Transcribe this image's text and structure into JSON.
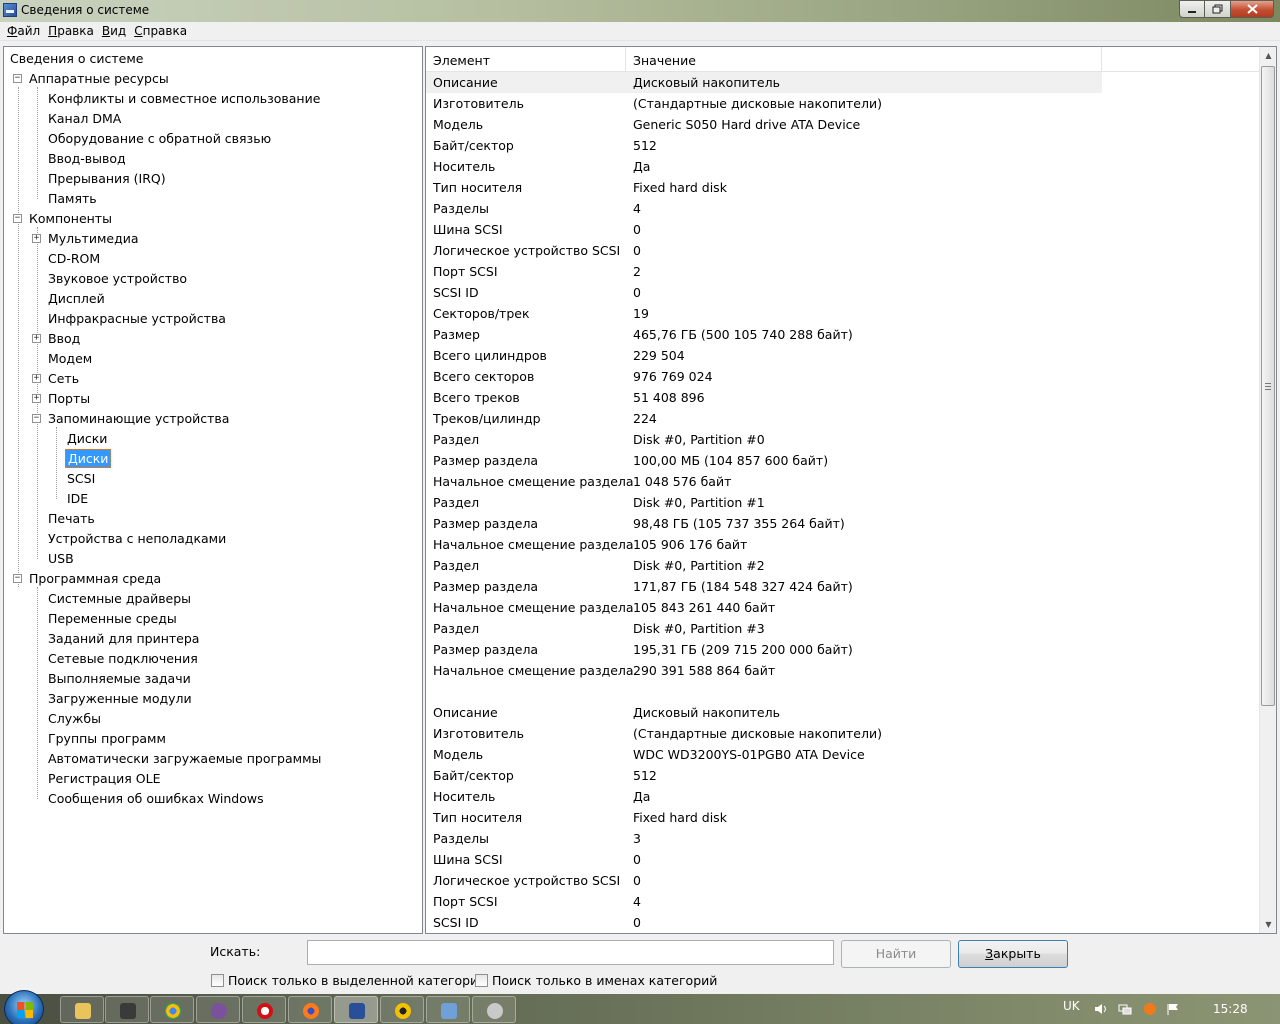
{
  "window": {
    "title": "Сведения о системе"
  },
  "menu": [
    {
      "label_ul": "Ф",
      "label_rest": "айл"
    },
    {
      "label_ul": "П",
      "label_rest": "равка"
    },
    {
      "label_ul": "В",
      "label_rest": "ид"
    },
    {
      "label_ul": "С",
      "label_rest": "правка"
    }
  ],
  "tree": [
    {
      "label": "Сведения о системе"
    },
    {
      "label": "Аппаратные ресурсы"
    },
    {
      "label": "Конфликты и совместное использование"
    },
    {
      "label": "Канал DMA"
    },
    {
      "label": "Оборудование с обратной связью"
    },
    {
      "label": "Ввод-вывод"
    },
    {
      "label": "Прерывания (IRQ)"
    },
    {
      "label": "Память"
    },
    {
      "label": "Компоненты"
    },
    {
      "label": "Мультимедиа"
    },
    {
      "label": "CD-ROM"
    },
    {
      "label": "Звуковое устройство"
    },
    {
      "label": "Дисплей"
    },
    {
      "label": "Инфракрасные устройства"
    },
    {
      "label": "Ввод"
    },
    {
      "label": "Модем"
    },
    {
      "label": "Сеть"
    },
    {
      "label": "Порты"
    },
    {
      "label": "Запоминающие устройства"
    },
    {
      "label": "Диски"
    },
    {
      "label": "Диски"
    },
    {
      "label": "SCSI"
    },
    {
      "label": "IDE"
    },
    {
      "label": "Печать"
    },
    {
      "label": "Устройства с неполадками"
    },
    {
      "label": "USB"
    },
    {
      "label": "Программная среда"
    },
    {
      "label": "Системные драйверы"
    },
    {
      "label": "Переменные среды"
    },
    {
      "label": "Заданий для принтера"
    },
    {
      "label": "Сетевые подключения"
    },
    {
      "label": "Выполняемые задачи"
    },
    {
      "label": "Загруженные модули"
    },
    {
      "label": "Службы"
    },
    {
      "label": "Группы программ"
    },
    {
      "label": "Автоматически загружаемые программы"
    },
    {
      "label": "Регистрация OLE"
    },
    {
      "label": "Сообщения об ошибках Windows"
    }
  ],
  "list": {
    "columns": [
      "Элемент",
      "Значение"
    ],
    "rows": [
      [
        "Описание",
        "Дисковый накопитель"
      ],
      [
        "Изготовитель",
        "(Стандартные дисковые накопители)"
      ],
      [
        "Модель",
        "Generic S050 Hard drive ATA Device"
      ],
      [
        "Байт/сектор",
        "512"
      ],
      [
        "Носитель",
        "Да"
      ],
      [
        "Тип носителя",
        "Fixed hard disk"
      ],
      [
        "Разделы",
        "4"
      ],
      [
        "Шина SCSI",
        "0"
      ],
      [
        "Логическое устройство SCSI",
        "0"
      ],
      [
        "Порт SCSI",
        "2"
      ],
      [
        "SCSI ID",
        "0"
      ],
      [
        "Секторов/трек",
        "19"
      ],
      [
        "Размер",
        "465,76 ГБ (500 105 740 288 байт)"
      ],
      [
        "Всего цилиндров",
        "229 504"
      ],
      [
        "Всего секторов",
        "976 769 024"
      ],
      [
        "Всего треков",
        "51 408 896"
      ],
      [
        "Треков/цилиндр",
        "224"
      ],
      [
        "Раздел",
        "Disk #0, Partition #0"
      ],
      [
        "Размер раздела",
        "100,00 МБ (104 857 600 байт)"
      ],
      [
        "Начальное смещение раздела",
        "1 048 576 байт"
      ],
      [
        "Раздел",
        "Disk #0, Partition #1"
      ],
      [
        "Размер раздела",
        "98,48 ГБ (105 737 355 264 байт)"
      ],
      [
        "Начальное смещение раздела",
        "105 906 176 байт"
      ],
      [
        "Раздел",
        "Disk #0, Partition #2"
      ],
      [
        "Размер раздела",
        "171,87 ГБ (184 548 327 424 байт)"
      ],
      [
        "Начальное смещение раздела",
        "105 843 261 440 байт"
      ],
      [
        "Раздел",
        "Disk #0, Partition #3"
      ],
      [
        "Размер раздела",
        "195,31 ГБ (209 715 200 000 байт)"
      ],
      [
        "Начальное смещение раздела",
        "290 391 588 864 байт"
      ],
      [
        "",
        ""
      ],
      [
        "Описание",
        "Дисковый накопитель"
      ],
      [
        "Изготовитель",
        "(Стандартные дисковые накопители)"
      ],
      [
        "Модель",
        "WDC WD3200YS-01PGB0 ATA Device"
      ],
      [
        "Байт/сектор",
        "512"
      ],
      [
        "Носитель",
        "Да"
      ],
      [
        "Тип носителя",
        "Fixed hard disk"
      ],
      [
        "Разделы",
        "3"
      ],
      [
        "Шина SCSI",
        "0"
      ],
      [
        "Логическое устройство SCSI",
        "0"
      ],
      [
        "Порт SCSI",
        "4"
      ],
      [
        "SCSI ID",
        "0"
      ]
    ]
  },
  "search": {
    "label": "Искать:",
    "value": "",
    "find_label": "Найти",
    "close_label": "Закрыть",
    "check_selected": "Поиск только в выделенной категории",
    "check_names": "Поиск только в именах категорий"
  },
  "taskbar": {
    "lang": "UK",
    "time": "15:28"
  }
}
